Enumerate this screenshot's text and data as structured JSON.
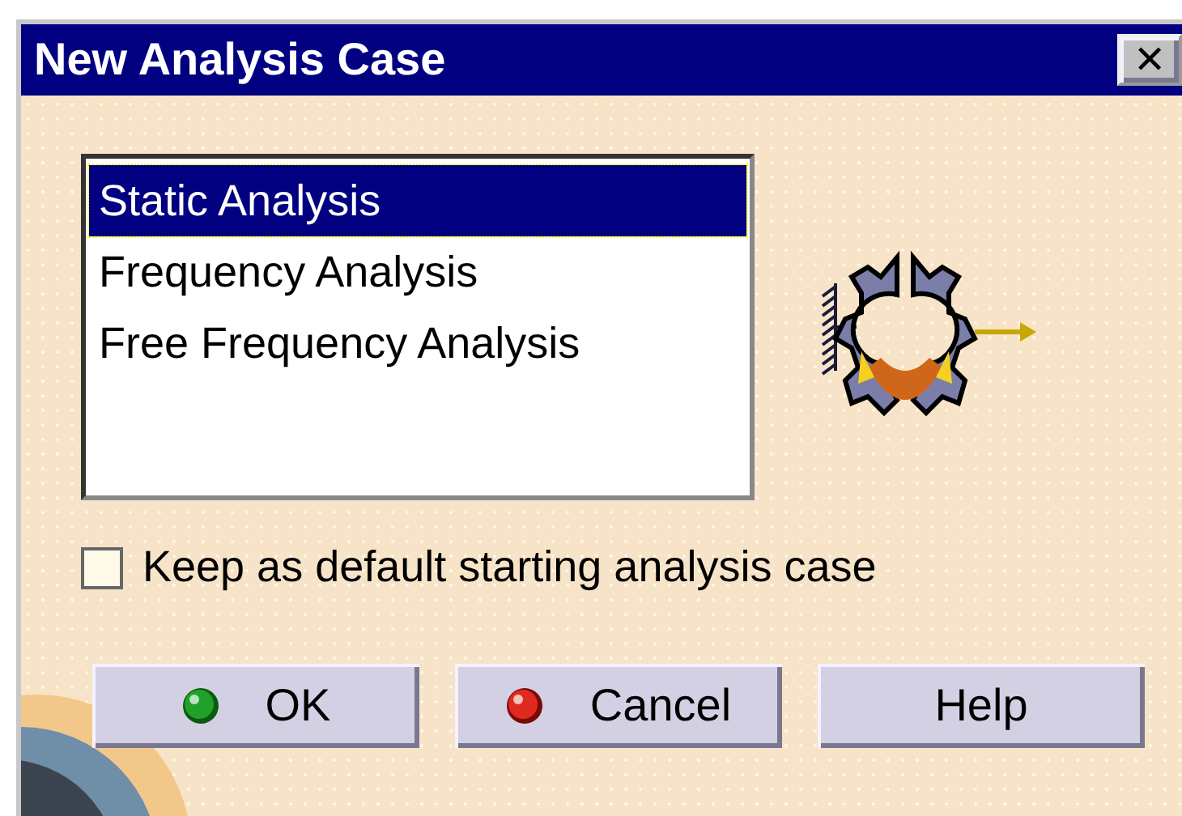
{
  "window": {
    "title": "New Analysis Case",
    "close": "✕"
  },
  "list": {
    "items": [
      {
        "label": "Static Analysis",
        "selected": true
      },
      {
        "label": "Frequency Analysis",
        "selected": false
      },
      {
        "label": "Free Frequency Analysis",
        "selected": false
      }
    ]
  },
  "checkbox": {
    "label": "Keep as default starting analysis case",
    "checked": false
  },
  "buttons": [
    {
      "label": "OK",
      "kind": "ok"
    },
    {
      "label": "Cancel",
      "kind": "cancel"
    },
    {
      "label": "Help",
      "kind": "plain"
    }
  ]
}
